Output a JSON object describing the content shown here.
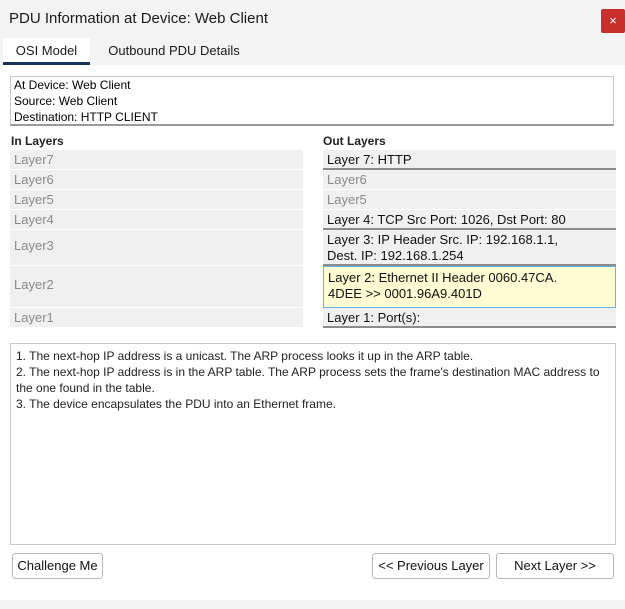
{
  "window": {
    "title": "PDU Information at Device: Web Client",
    "close_label": "×"
  },
  "tabs": [
    {
      "label": "OSI Model",
      "active": true
    },
    {
      "label": "Outbound PDU Details",
      "active": false
    }
  ],
  "info": {
    "device": "At Device: Web Client",
    "source": "Source: Web Client",
    "destination": "Destination: HTTP CLIENT"
  },
  "in_layers": {
    "header": "In Layers",
    "items": [
      "Layer7",
      "Layer6",
      "Layer5",
      "Layer4",
      "Layer3",
      "Layer2",
      "Layer1"
    ]
  },
  "out_layers": {
    "header": "Out Layers",
    "items": [
      {
        "line1": "Layer 7: HTTP",
        "line2": ""
      },
      {
        "line1": "Layer6",
        "line2": ""
      },
      {
        "line1": "Layer5",
        "line2": ""
      },
      {
        "line1": "Layer 4: TCP Src Port: 1026, Dst Port: 80",
        "line2": ""
      },
      {
        "line1": "Layer 3: IP Header Src. IP: 192.168.1.1,",
        "line2": "Dest. IP: 192.168.1.254"
      },
      {
        "line1": "Layer 2: Ethernet II Header 0060.47CA.",
        "line2": "4DEE >> 0001.96A9.401D"
      },
      {
        "line1": "Layer 1: Port(s):",
        "line2": ""
      }
    ],
    "selected_index": 5
  },
  "description": [
    "1. The next-hop IP address is a unicast. The ARP process looks it up in the ARP table.",
    "2. The next-hop IP address is in the ARP table. The ARP process sets the frame's destination MAC address to the one found in the table.",
    "3. The device encapsulates the PDU into an Ethernet frame."
  ],
  "buttons": {
    "challenge": "Challenge Me",
    "previous": "<< Previous Layer",
    "next": "Next Layer >>"
  },
  "colors": {
    "close_button": "#c9302c",
    "active_tab_underline": "#17365d",
    "selected_layer_bg": "#fffbd2",
    "selected_layer_border": "#63b4e6"
  }
}
